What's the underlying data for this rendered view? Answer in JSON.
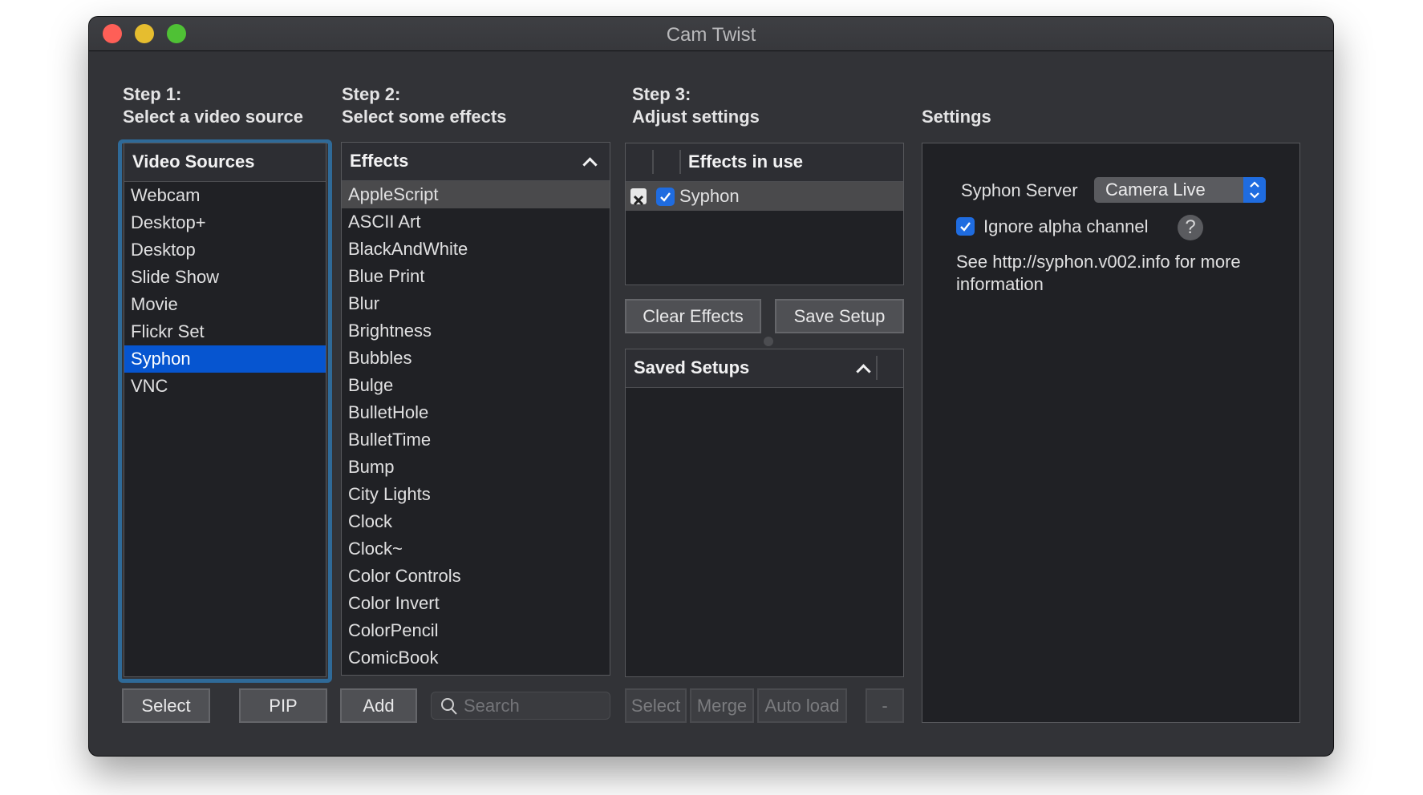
{
  "window": {
    "title": "Cam Twist"
  },
  "steps": {
    "step1": {
      "line1": "Step 1:",
      "line2": "Select a video source"
    },
    "step2": {
      "line1": "Step 2:",
      "line2": "Select some effects"
    },
    "step3": {
      "line1": "Step 3:",
      "line2": "Adjust settings"
    },
    "settings": {
      "label": "Settings"
    }
  },
  "video_sources": {
    "header": "Video Sources",
    "items": [
      "Webcam",
      "Desktop+",
      "Desktop",
      "Slide Show",
      "Movie",
      "Flickr Set",
      "Syphon",
      "VNC"
    ],
    "selected": "Syphon",
    "buttons": {
      "select": "Select",
      "pip": "PIP"
    }
  },
  "effects": {
    "header": "Effects",
    "items": [
      "AppleScript",
      "ASCII Art",
      "BlackAndWhite",
      "Blue Print",
      "Blur",
      "Brightness",
      "Bubbles",
      "Bulge",
      "BulletHole",
      "BulletTime",
      "Bump",
      "City Lights",
      "Clock",
      "Clock~",
      "Color Controls",
      "Color Invert",
      "ColorPencil",
      "ComicBook"
    ],
    "highlighted": "AppleScript",
    "add_label": "Add",
    "search_placeholder": "Search"
  },
  "effects_in_use": {
    "header": "Effects in use",
    "items": [
      {
        "name": "Syphon",
        "enabled": true
      }
    ],
    "buttons": {
      "clear": "Clear Effects",
      "save": "Save Setup"
    }
  },
  "saved_setups": {
    "header": "Saved Setups",
    "items": [],
    "buttons": {
      "select": "Select",
      "merge": "Merge",
      "auto_load": "Auto load",
      "remove": "-"
    }
  },
  "settings_panel": {
    "server_label": "Syphon Server",
    "server_value": "Camera Live",
    "ignore_alpha_label": "Ignore alpha channel",
    "ignore_alpha_checked": true,
    "help_label": "?",
    "info_line1": "See http://syphon.v002.info for more",
    "info_line2": "information"
  },
  "colors": {
    "accent": "#1f6ce0",
    "selection": "#0655d0",
    "focus_ring": "#2f6a98",
    "window_bg": "#323337",
    "list_bg": "#202125"
  }
}
